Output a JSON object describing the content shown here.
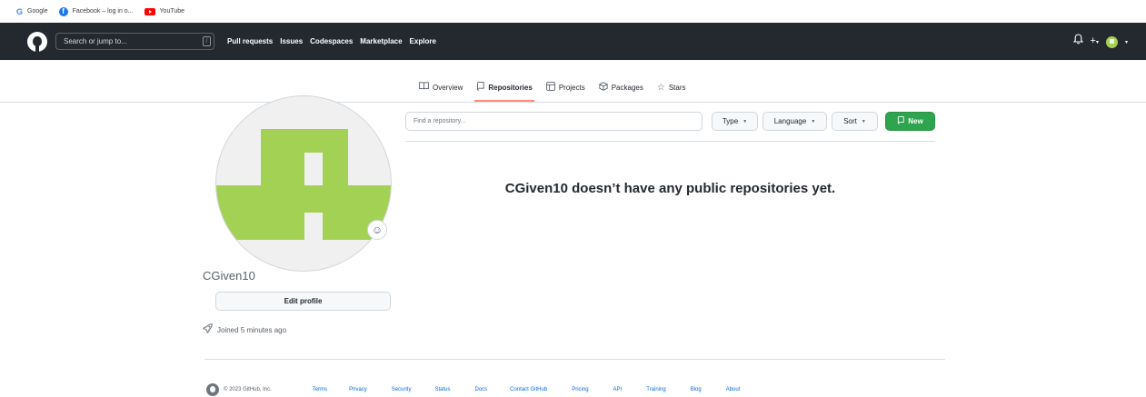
{
  "bookmarks": [
    {
      "icon": "google-icon",
      "label": "Google"
    },
    {
      "icon": "facebook-icon",
      "label": "Facebook – log in o..."
    },
    {
      "icon": "youtube-icon",
      "label": "YouTube"
    }
  ],
  "header": {
    "search_placeholder": "Search or jump to...",
    "search_shortcut": "/",
    "nav": [
      "Pull requests",
      "Issues",
      "Codespaces",
      "Marketplace",
      "Explore"
    ],
    "icons": [
      "bell-icon",
      "plus-icon",
      "avatar"
    ]
  },
  "tabs": [
    {
      "icon": "book-icon",
      "label": "Overview",
      "active": false
    },
    {
      "icon": "repo-icon",
      "label": "Repositories",
      "active": true
    },
    {
      "icon": "table-icon",
      "label": "Projects",
      "active": false
    },
    {
      "icon": "package-icon",
      "label": "Packages",
      "active": false
    },
    {
      "icon": "star-icon",
      "label": "Stars",
      "active": false
    }
  ],
  "profile": {
    "username": "CGiven10",
    "edit_label": "Edit profile",
    "joined": "Joined 5 minutes ago",
    "avatar_color": "#a3d154"
  },
  "repos": {
    "search_placeholder": "Find a repository...",
    "filters": {
      "type": "Type",
      "language": "Language",
      "sort": "Sort"
    },
    "new_label": "New",
    "empty_message": "CGiven10 doesn’t have any public repositories yet."
  },
  "footer": {
    "copyright": "© 2023 GitHub, Inc.",
    "links": [
      "Terms",
      "Privacy",
      "Security",
      "Status",
      "Docs",
      "Contact GitHub",
      "Pricing",
      "API",
      "Training",
      "Blog",
      "About"
    ]
  },
  "colors": {
    "header_bg": "#24292f",
    "new_button": "#2da44e",
    "tab_underline": "#fd8c73",
    "link": "#0969da"
  }
}
